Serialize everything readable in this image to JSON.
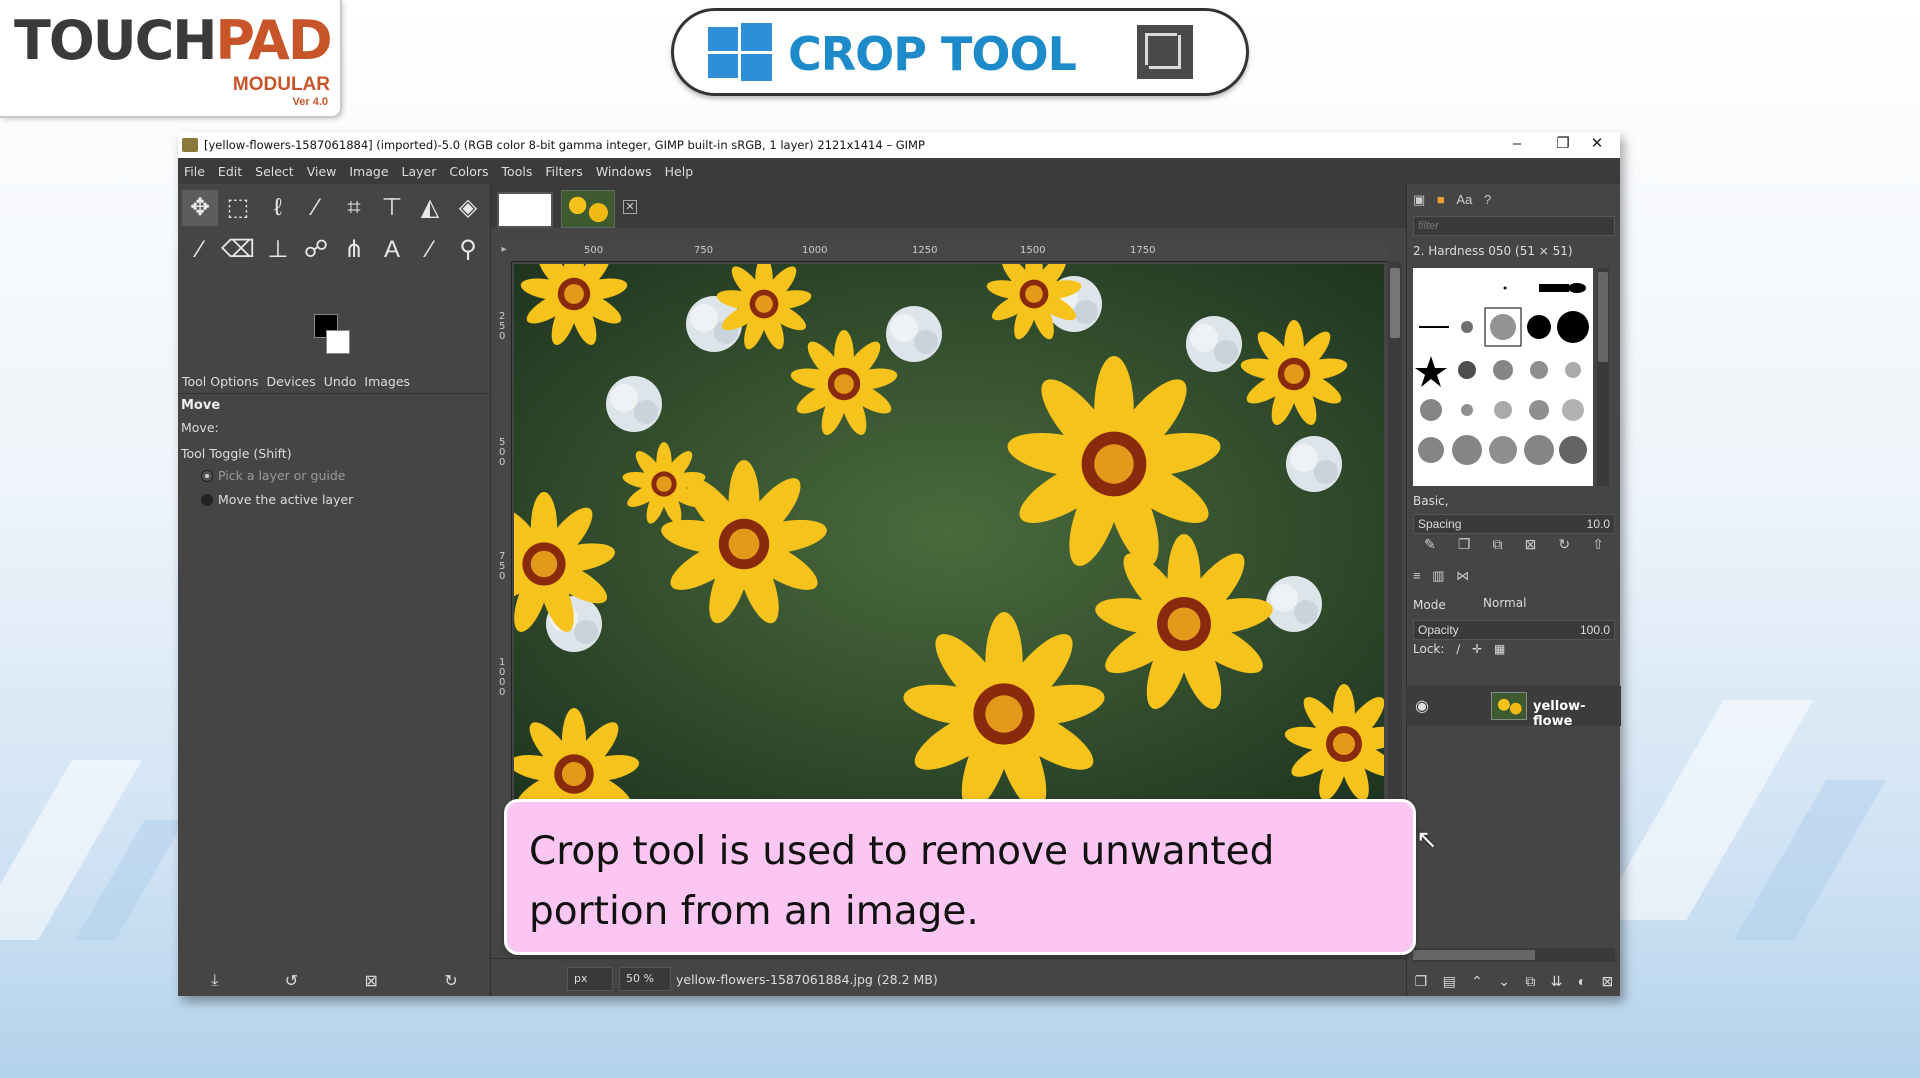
{
  "logo": {
    "main_a": "TOUCH",
    "main_b": "PAD",
    "sub": "MODULAR",
    "version": "Ver 4.0"
  },
  "banner": {
    "title": "CROP TOOL"
  },
  "window": {
    "title": "[yellow-flowers-1587061884] (imported)-5.0 (RGB color 8-bit gamma integer, GIMP built-in sRGB, 1 layer) 2121x1414 – GIMP",
    "minimize": "–",
    "restore": "❐",
    "close": "✕"
  },
  "menu": [
    "File",
    "Edit",
    "Select",
    "View",
    "Image",
    "Layer",
    "Colors",
    "Tools",
    "Filters",
    "Windows",
    "Help"
  ],
  "toolbox": {
    "tabs": {
      "tool_options": "Tool Options",
      "devices": "Devices",
      "undo": "Undo",
      "images": "Images"
    },
    "tool_title": "Move",
    "move_label": "Move:",
    "toggle_label": "Tool Toggle  (Shift)",
    "option_pick": "Pick a layer or guide",
    "option_move": "Move the active layer"
  },
  "ruler": {
    "h_labels": [
      "500",
      "750",
      "1000",
      "1250",
      "1500",
      "1750"
    ],
    "v_labels": [
      "250",
      "500",
      "750",
      "1000"
    ]
  },
  "status": {
    "unit": "px",
    "zoom": "50 %",
    "file": "yellow-flowers-1587061884.jpg (28.2 MB)"
  },
  "dock": {
    "filter_placeholder": "filter",
    "brush_name": "2. Hardness 050 (51 × 51)",
    "brush_set": "Basic,",
    "spacing_label": "Spacing",
    "spacing_value": "10.0",
    "mode_label": "Mode",
    "mode_value": "Normal",
    "opacity_label": "Opacity",
    "opacity_value": "100.0",
    "lock_label": "Lock:",
    "layer_name": "yellow-flowe"
  },
  "caption": {
    "text": "Crop tool is used to remove unwanted portion from an image."
  },
  "colors": {
    "foreground": "#000000",
    "background": "#ffffff",
    "caption_bg": "#fbc6f2"
  }
}
